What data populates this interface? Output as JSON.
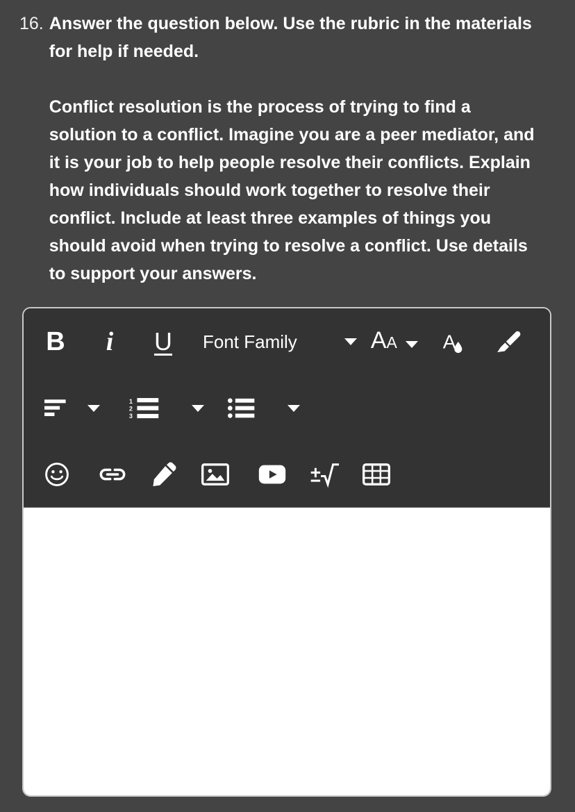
{
  "question": {
    "number": "16.",
    "prompt": "Answer the question below. Use the rubric in the materials for help if needed.",
    "passage": "Conflict resolution is the process of trying to find a solution to a conflict. Imagine you are a peer mediator, and it is your job to help people resolve their conflicts. Explain how individuals should work together to resolve their conflict. Include at least three examples of things you should avoid when trying to resolve a conflict. Use details to support your answers."
  },
  "editor": {
    "toolbar": {
      "row1": {
        "bold_label": "B",
        "italic_label": "i",
        "underline_label": "U",
        "font_family_label": "Font Family",
        "font_family_caret": "chevron-down-icon",
        "font_size_big": "A",
        "font_size_small": "A",
        "font_size_caret": "chevron-down-icon",
        "text_color_icon": "text-color-icon",
        "highlighter_icon": "highlighter-icon"
      },
      "row2": {
        "align_icon": "align-left-icon",
        "align_caret": "chevron-down-icon",
        "numbered_list_icon": "numbered-list-icon",
        "numbered_list_caret": "chevron-down-icon",
        "bulleted_list_icon": "bulleted-list-icon",
        "bulleted_list_caret": "chevron-down-icon",
        "numbered_list_digits": [
          "1",
          "2",
          "3"
        ]
      },
      "row3": {
        "emoji_icon": "smiley-icon",
        "link_icon": "link-icon",
        "draw_icon": "pencil-icon",
        "image_icon": "image-icon",
        "video_icon": "video-icon",
        "equation_icon": "math-equation-icon",
        "table_icon": "table-icon"
      }
    },
    "content": {
      "value": "",
      "placeholder": ""
    }
  },
  "colors": {
    "page_background": "#444444",
    "toolbar_background": "#333333",
    "editor_border": "#c9c9c9",
    "icon_color": "#ffffff",
    "text_color": "#ffffff",
    "content_background": "#ffffff"
  }
}
